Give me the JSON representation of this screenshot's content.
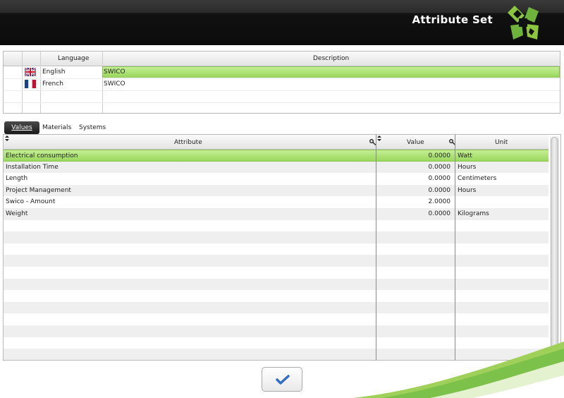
{
  "header": {
    "title": "Attribute Set"
  },
  "language_table": {
    "headers": {
      "language": "Language",
      "description": "Description"
    },
    "rows": [
      {
        "flag": "uk-flag-icon",
        "language": "English",
        "description": "SWICO",
        "selected": true
      },
      {
        "flag": "france-flag-icon",
        "language": "French",
        "description": "SWICO",
        "selected": false
      }
    ]
  },
  "tabs": [
    "Values",
    "Materials",
    "Systems"
  ],
  "active_tab": "Values",
  "attribute_table": {
    "headers": {
      "attribute": "Attribute",
      "value": "Value",
      "unit": "Unit"
    },
    "rows": [
      {
        "attribute": "Electrical consumption",
        "value": "0.0000",
        "unit": "Watt",
        "selected": true
      },
      {
        "attribute": "Installation Time",
        "value": "0.0000",
        "unit": "Hours"
      },
      {
        "attribute": "Length",
        "value": "0.0000",
        "unit": "Centimeters"
      },
      {
        "attribute": "Project Management",
        "value": "0.0000",
        "unit": "Hours"
      },
      {
        "attribute": "Swico - Amount",
        "value": "2.0000",
        "unit": ""
      },
      {
        "attribute": "Weight",
        "value": "0.0000",
        "unit": "Kilograms"
      }
    ]
  },
  "confirm_button": {
    "icon": "checkmark-icon"
  },
  "colors": {
    "selection": "#9ad85e",
    "header_bg": "#111111",
    "accent_green": "#7cc24a"
  }
}
